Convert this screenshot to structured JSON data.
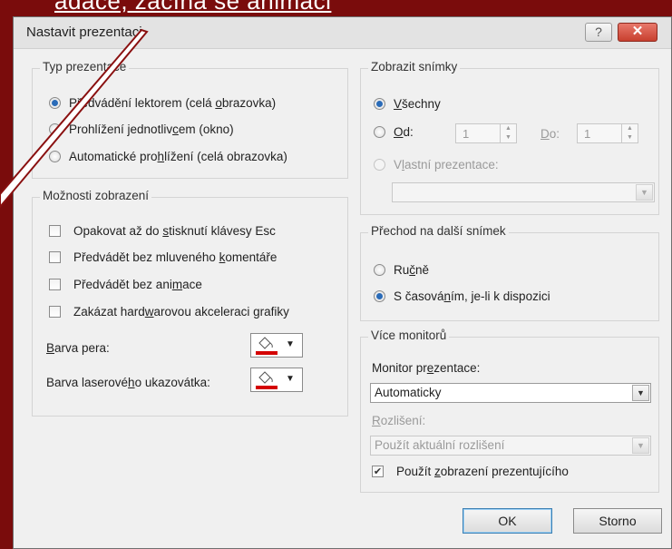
{
  "banner_text": "adace, začíná se animaci",
  "dialog": {
    "title": "Nastavit prezentaci",
    "help_glyph": "?",
    "close_glyph": "✕"
  },
  "show_type": {
    "legend": "Typ prezentace",
    "opt1": {
      "before": "Předvádění lektorem (celá ",
      "accel": "o",
      "after": "brazovka)",
      "checked": true
    },
    "opt2": {
      "before": "Prohlížení jednotliv",
      "accel": "c",
      "after": "em (okno)",
      "checked": false
    },
    "opt3": {
      "before": "Automatické pro",
      "accel": "h",
      "after": "lížení (celá obrazovka)",
      "checked": false
    }
  },
  "show_options": {
    "legend": "Možnosti zobrazení",
    "loop": {
      "before": "Opakovat až do ",
      "accel": "s",
      "after": "tisknutí klávesy Esc"
    },
    "no_narration": {
      "before": "Předvádět bez mluveného ",
      "accel": "k",
      "after": "omentáře"
    },
    "no_animation": {
      "before": "Předvádět bez ani",
      "accel": "m",
      "after": "ace"
    },
    "no_hw_accel": {
      "before": "Zakázat hard",
      "accel": "w",
      "after": "arovou akceleraci grafiky"
    },
    "pen_color": {
      "accel": "B",
      "after": "arva pera:"
    },
    "laser_color": {
      "before": "Barva laserové",
      "accel": "h",
      "after": "o ukazovátka:"
    },
    "color_dropdown_glyph": "▼"
  },
  "show_slides": {
    "legend": "Zobrazit snímky",
    "all": {
      "accel": "V",
      "after": "šechny",
      "checked": true
    },
    "from": {
      "accel": "O",
      "after": "d:",
      "value": "1"
    },
    "to": {
      "accel": "D",
      "after": "o:",
      "value": "1"
    },
    "custom": {
      "before": "V",
      "accel": "l",
      "after": "astní prezentace:"
    },
    "custom_value": ""
  },
  "advance": {
    "legend": "Přechod na další snímek",
    "manual": {
      "before": "Ru",
      "accel": "č",
      "after": "ně",
      "checked": false
    },
    "timings": {
      "before": "S časová",
      "accel": "n",
      "after": "ím, je-li k dispozici",
      "checked": true
    }
  },
  "monitors": {
    "legend": "Více monitorů",
    "monitor_label": {
      "before": "Monitor pr",
      "accel": "e",
      "after": "zentace:"
    },
    "monitor_value": "Automaticky",
    "resolution_label": {
      "accel": "R",
      "after": "ozlišení:"
    },
    "resolution_value": "Použít aktuální rozlišení",
    "presenter_view": {
      "before": "Použít ",
      "accel": "z",
      "after": "obrazení prezentujícího",
      "checked": true
    }
  },
  "buttons": {
    "ok": "OK",
    "cancel": "Storno"
  },
  "colors": {
    "window_frame": "#7a0c0c",
    "close_button": "#c8402f",
    "radio_selected": "#2a6bb8",
    "pen_red": "#d40000",
    "annotation_line": "#8a1010"
  }
}
